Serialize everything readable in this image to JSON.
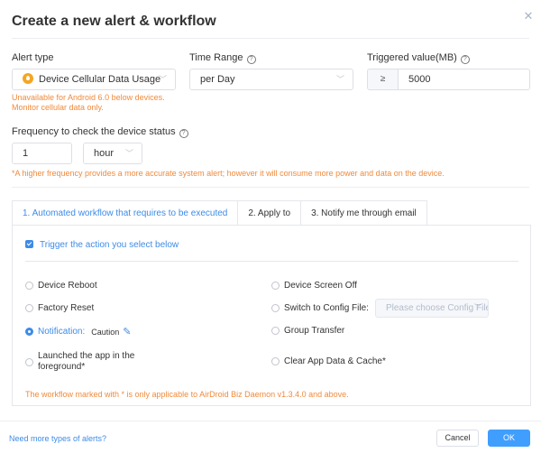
{
  "dialog": {
    "title": "Create a new alert & workflow",
    "close_icon": "close-icon"
  },
  "alert_type": {
    "label": "Alert type",
    "selected": "Device Cellular Data Usage",
    "icon": "cellular-data-icon",
    "note": "Unavailable for Android 6.0 below devices. Monitor cellular data only."
  },
  "time_range": {
    "label": "Time Range",
    "help_icon": "help-icon",
    "selected": "per Day"
  },
  "triggered_value": {
    "label": "Triggered value(MB)",
    "help_icon": "help-icon",
    "operator": "≥",
    "value": "5000"
  },
  "frequency": {
    "label": "Frequency to check the device status",
    "help_icon": "help-icon",
    "value": "1",
    "unit": "hour",
    "note": "*A higher frequency provides a more accurate system alert; however it will consume more power and data on the device."
  },
  "tabs": [
    {
      "label": "1. Automated workflow that requires to be executed",
      "active": true
    },
    {
      "label": "2. Apply to",
      "active": false
    },
    {
      "label": "3. Notify me through email",
      "active": false
    }
  ],
  "workflow": {
    "trigger_checkbox": {
      "label": "Trigger the action you select below",
      "checked": true
    },
    "options_left": [
      {
        "label": "Device Reboot",
        "selected": false
      },
      {
        "label": "Factory Reset",
        "selected": false
      },
      {
        "label": "Notification:",
        "selected": true,
        "value": "Caution"
      },
      {
        "label": "Launched the app in the foreground*",
        "line1": "Launched the app in the",
        "line2": "foreground*",
        "selected": false
      }
    ],
    "options_right": [
      {
        "label": "Device Screen Off",
        "selected": false
      },
      {
        "label": "Switch to Config File:",
        "selected": false,
        "placeholder": "Please choose Config File"
      },
      {
        "label": "Group Transfer",
        "selected": false
      },
      {
        "label": "Clear App Data & Cache*",
        "selected": false
      }
    ],
    "footnote": "The workflow marked with * is only applicable to AirDroid Biz Daemon v1.3.4.0 and above."
  },
  "footer": {
    "more_link": "Need more types of alerts?",
    "cancel_label": "Cancel",
    "ok_label": "OK"
  },
  "colors": {
    "accent": "#409eff",
    "link": "#3e8be8",
    "warning": "#f08a3c",
    "alert_icon": "#f5a623"
  }
}
